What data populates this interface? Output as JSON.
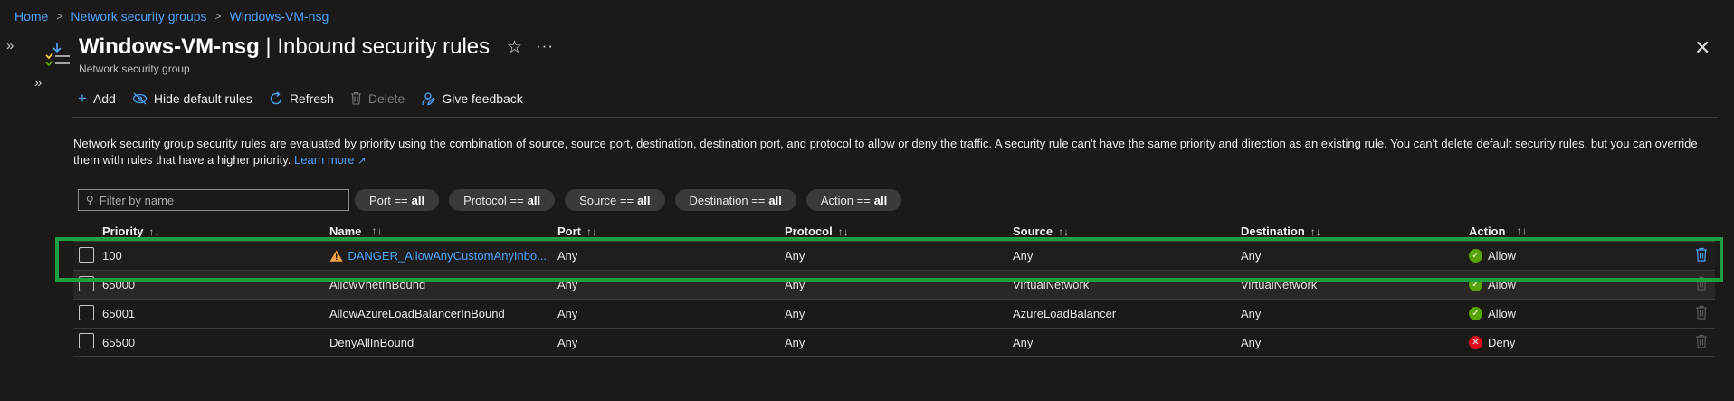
{
  "breadcrumb": [
    "Home",
    "Network security groups",
    "Windows-VM-nsg"
  ],
  "header": {
    "title_bold": "Windows-VM-nsg",
    "title_rest": " | Inbound security rules",
    "subtitle": "Network security group"
  },
  "toolbar": {
    "add": "Add",
    "hide_default": "Hide default rules",
    "refresh": "Refresh",
    "delete": "Delete",
    "feedback": "Give feedback"
  },
  "description": {
    "text": "Network security group security rules are evaluated by priority using the combination of source, source port, destination, destination port, and protocol to allow or deny the traffic. A security rule can't have the same priority and direction as an existing rule. You can't delete default security rules, but you can override them with rules that have a higher priority.",
    "learn_more": "Learn more"
  },
  "filter": {
    "placeholder": "Filter by name"
  },
  "pills": [
    {
      "label": "Port == ",
      "value": "all"
    },
    {
      "label": "Protocol == ",
      "value": "all"
    },
    {
      "label": "Source == ",
      "value": "all"
    },
    {
      "label": "Destination == ",
      "value": "all"
    },
    {
      "label": "Action == ",
      "value": "all"
    }
  ],
  "columns": [
    "Priority",
    "Name",
    "Port",
    "Protocol",
    "Source",
    "Destination",
    "Action"
  ],
  "sort_glyph": "↑↓",
  "rows": [
    {
      "priority": "100",
      "name": "DANGER_AllowAnyCustomAnyInbo...",
      "port": "Any",
      "protocol": "Any",
      "source": "Any",
      "destination": "Any",
      "action": "Allow"
    },
    {
      "priority": "65000",
      "name": "AllowVnetInBound",
      "port": "Any",
      "protocol": "Any",
      "source": "VirtualNetwork",
      "destination": "VirtualNetwork",
      "action": "Allow"
    },
    {
      "priority": "65001",
      "name": "AllowAzureLoadBalancerInBound",
      "port": "Any",
      "protocol": "Any",
      "source": "AzureLoadBalancer",
      "destination": "Any",
      "action": "Allow"
    },
    {
      "priority": "65500",
      "name": "DenyAllInBound",
      "port": "Any",
      "protocol": "Any",
      "source": "Any",
      "destination": "Any",
      "action": "Deny"
    }
  ],
  "colors": {
    "accent": "#4ea1ff",
    "allow": "#57a300",
    "deny": "#e00b1c",
    "warning": "#f7a24a",
    "highlight": "#1e9e42"
  }
}
